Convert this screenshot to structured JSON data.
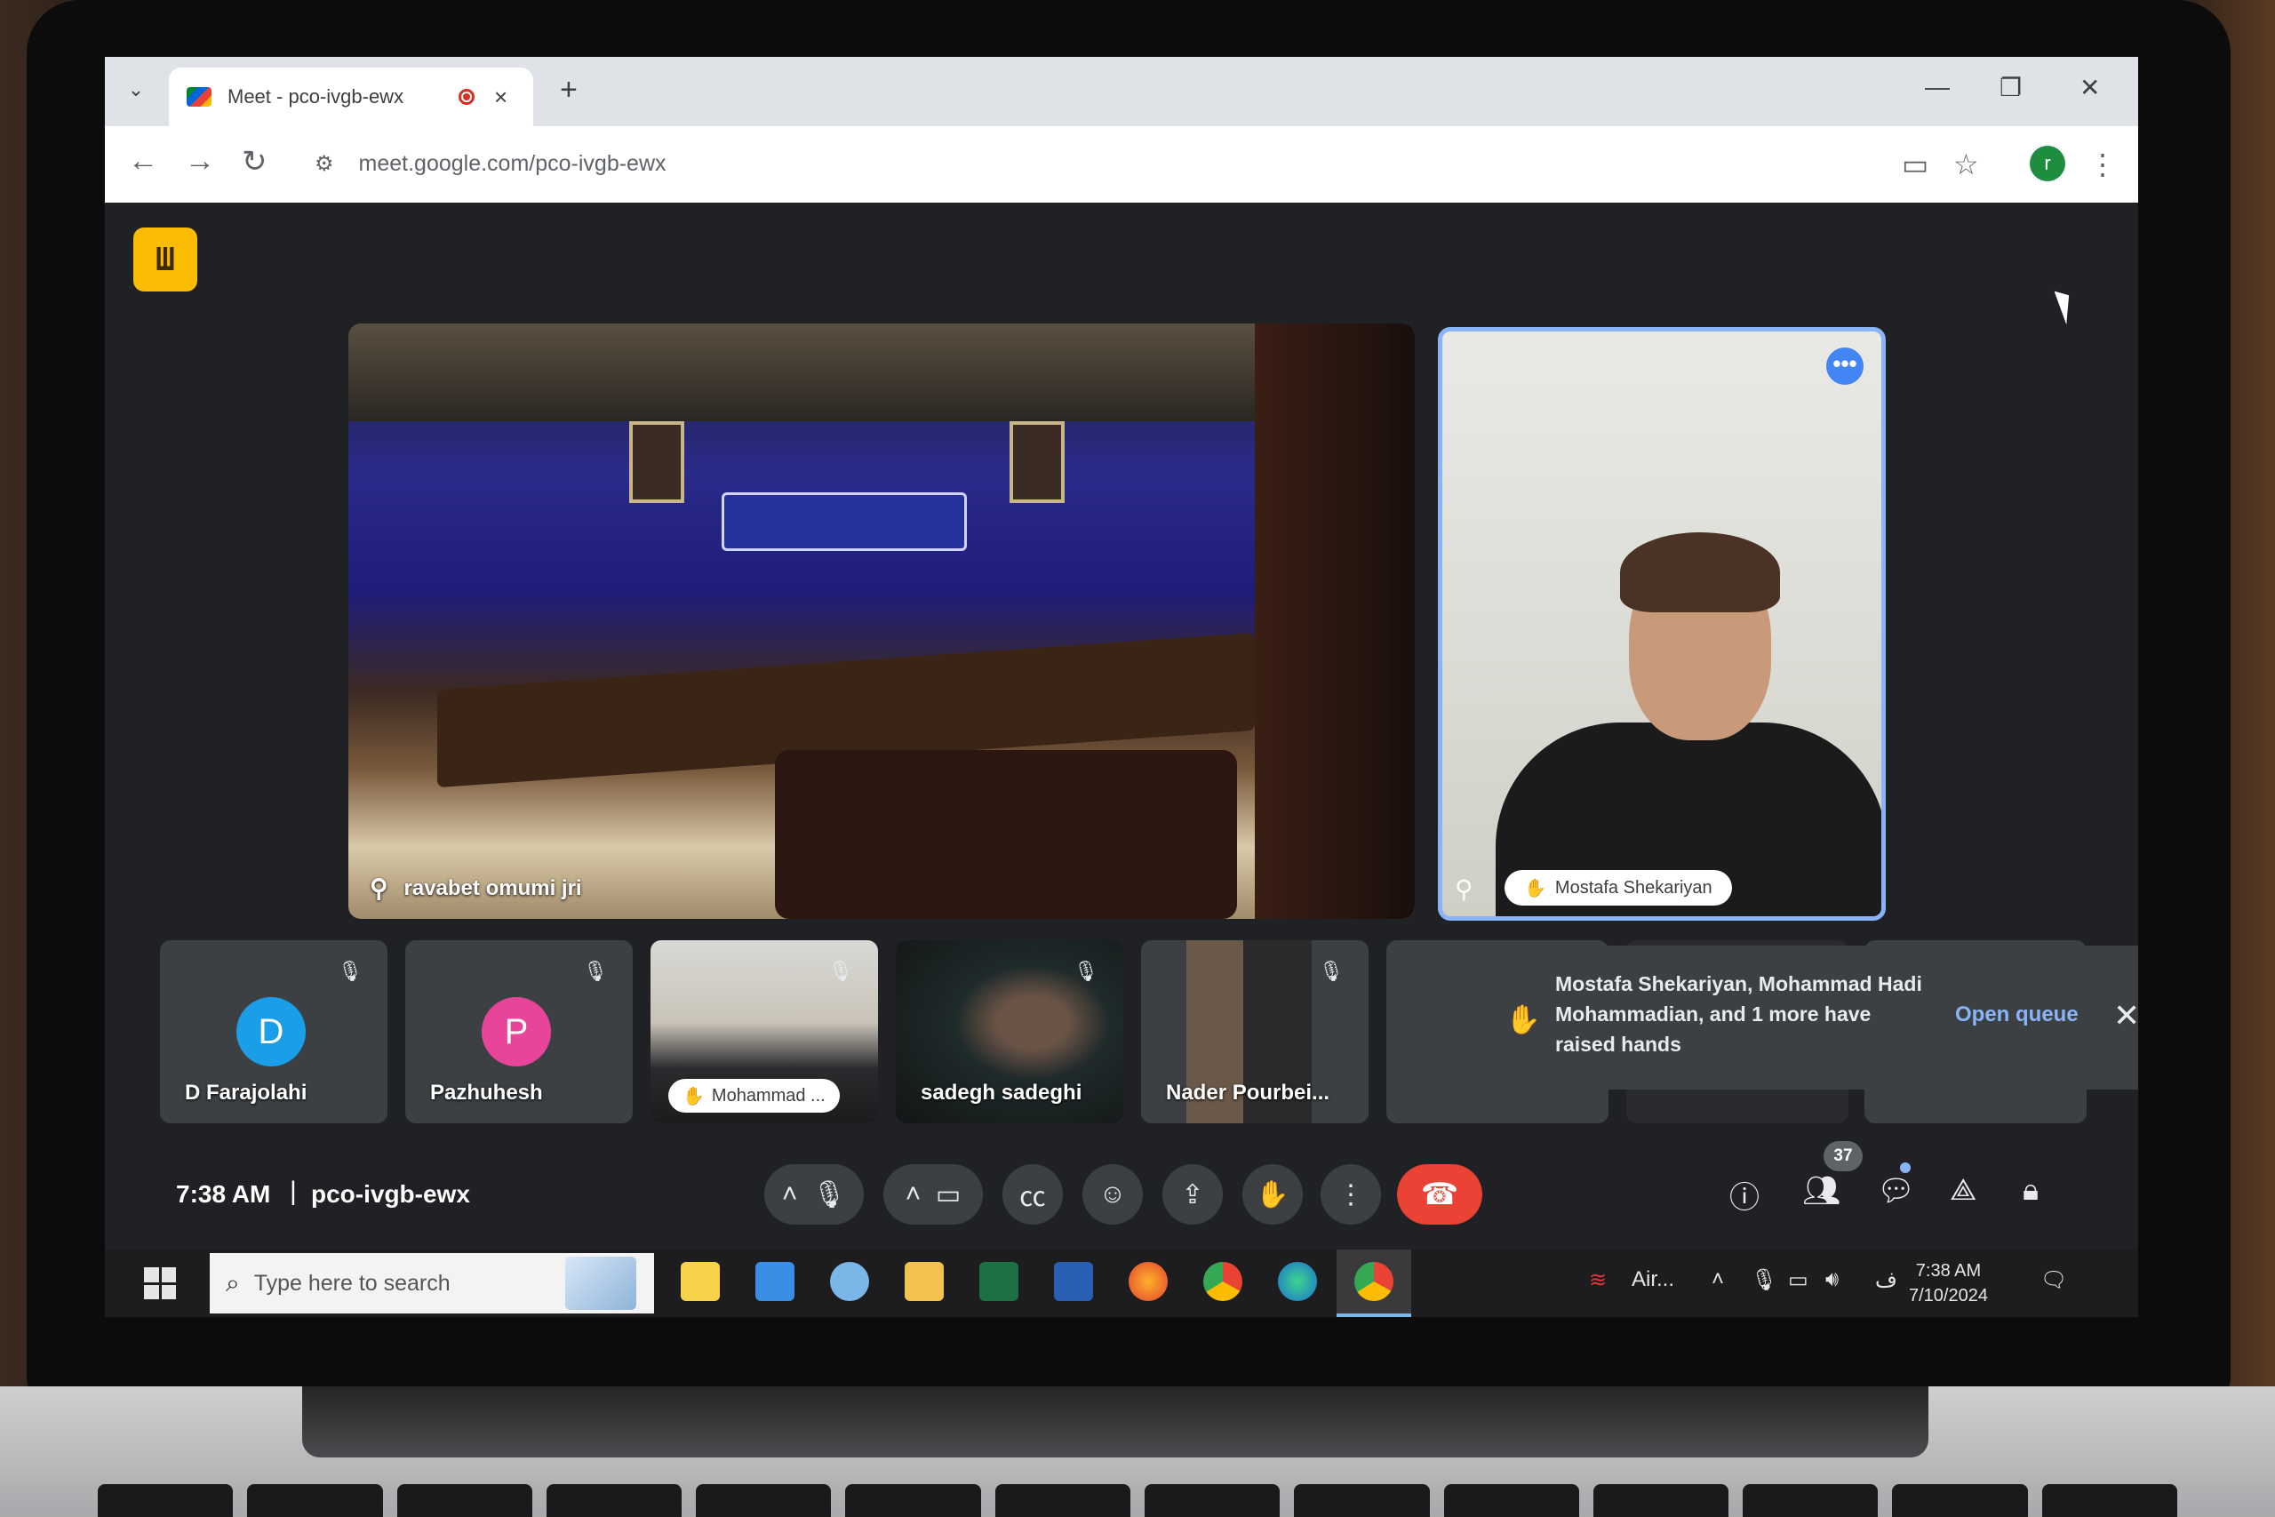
{
  "browser": {
    "tab_title": "Meet - pco-ivgb-ewx",
    "tab_close": "×",
    "tab_list_icon": "⌄",
    "new_tab": "+",
    "url": "meet.google.com/pco-ivgb-ewx",
    "profile_initial": "r",
    "window_minimize": "—",
    "window_restore": "❐",
    "window_close": "✕"
  },
  "meet": {
    "main_tile_name": "ravabet omumi jri",
    "speaker_name": "Mostafa Shekariyan",
    "more_options": "•••",
    "participants": [
      {
        "name": "D Farajolahi",
        "initial": "D",
        "avatar_color": "#1a9ee8",
        "type": "avatar"
      },
      {
        "name": "Pazhuhesh",
        "initial": "P",
        "avatar_color": "#e8459a",
        "type": "avatar"
      },
      {
        "name": "Mohammad ...",
        "type": "video-chip"
      },
      {
        "name": "sadegh sadeghi",
        "type": "video"
      },
      {
        "name": "Nader Pourbei...",
        "type": "video"
      }
    ],
    "notice": {
      "text": "Mostafa Shekariyan, Mohammad Hadi Mohammadian, and 1 more have raised hands",
      "action": "Open queue",
      "close": "✕"
    },
    "controls": {
      "time": "7:38 AM",
      "separator": "|",
      "meeting_code": "pco-ivgb-ewx",
      "participant_count": "37"
    }
  },
  "taskbar": {
    "search_placeholder": "Type here to search",
    "weather_label": "Air...",
    "ime_label": "ف",
    "time": "7:38 AM",
    "date": "7/10/2024"
  },
  "colors": {
    "meet_bg": "#202124",
    "tile_bg": "#3c4043",
    "end_call": "#ea4335",
    "active_speaker_border": "#8ab4f8",
    "link": "#8ab4f8"
  }
}
